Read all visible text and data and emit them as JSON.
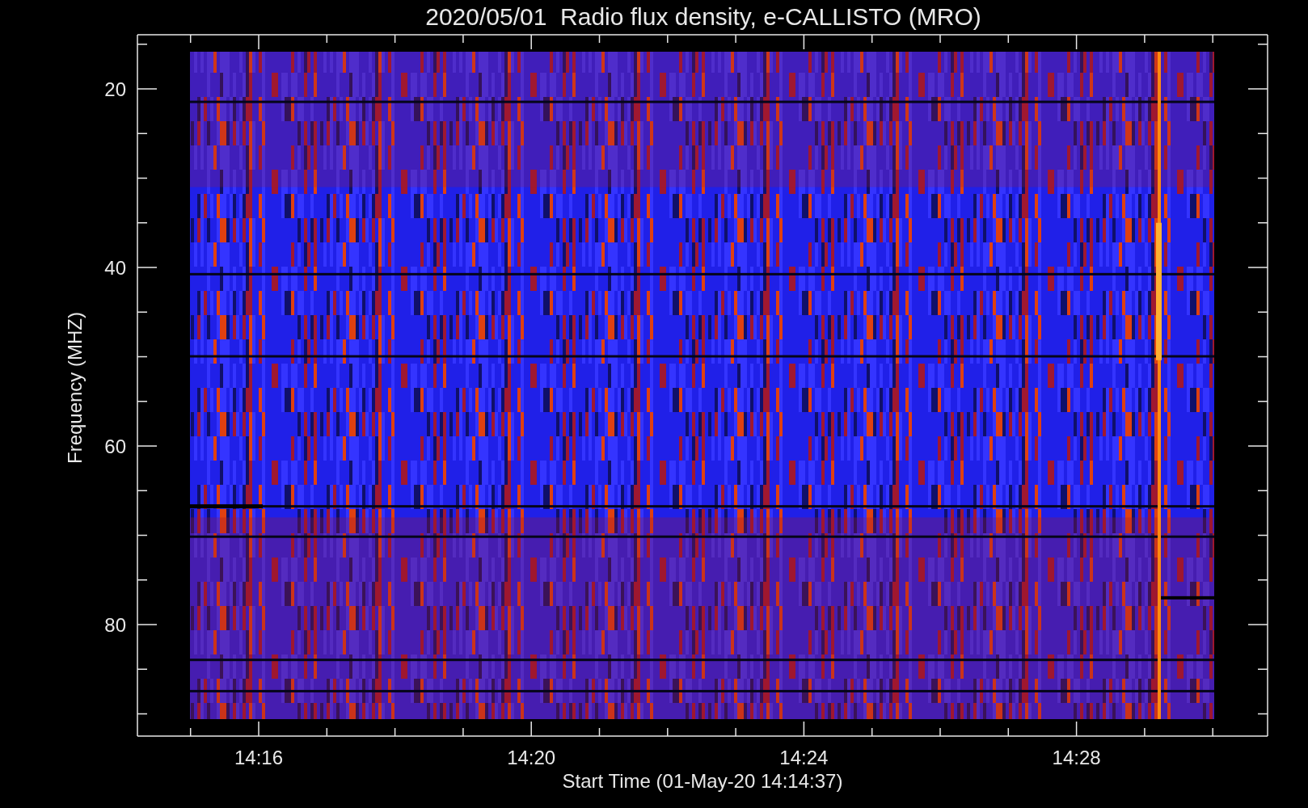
{
  "title": "2020/05/01  Radio flux density, e-CALLISTO (MRO)",
  "y_axis": {
    "label": "Frequency (MHZ)",
    "ticks": [
      "20",
      "40",
      "60",
      "80"
    ]
  },
  "x_axis": {
    "label": "Start Time (01-May-20 14:14:37)",
    "ticks": [
      "14:16",
      "14:20",
      "14:24",
      "14:28"
    ]
  }
}
